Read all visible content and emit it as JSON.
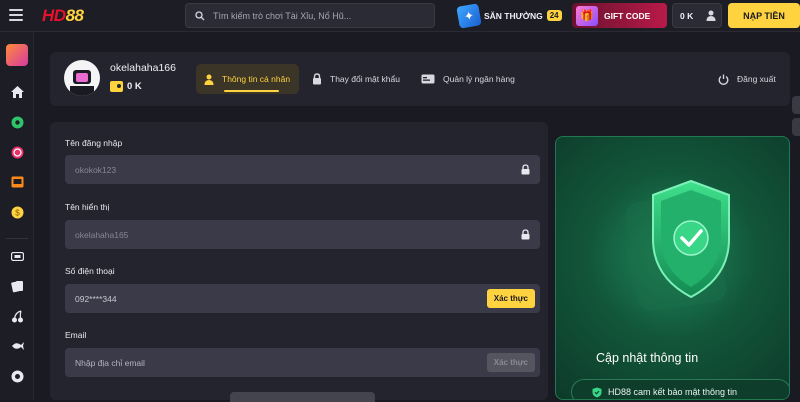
{
  "brand": {
    "logo_text_a": "HD",
    "logo_text_b": "88"
  },
  "search": {
    "placeholder": "Tìm kiếm trò chơi Tài Xỉu, Nổ Hũ..."
  },
  "header": {
    "reward_label": "SĂN THƯỞNG",
    "reward_count": "24",
    "gift_label": "GIFT CODE",
    "balance": "0 K",
    "deposit_label": "NẠP TIỀN"
  },
  "profile": {
    "username": "okelahaha166",
    "coins": "0 K",
    "tabs": [
      {
        "label": "Thông tin cá nhân",
        "icon": "user-icon",
        "active": true
      },
      {
        "label": "Thay đổi mật khẩu",
        "icon": "lock-icon",
        "active": false
      },
      {
        "label": "Quản lý ngân hàng",
        "icon": "bank-card-icon",
        "active": false
      }
    ],
    "logout_label": "Đăng xuất"
  },
  "form": {
    "username_label": "Tên đăng nhập",
    "username_value": "okokok123",
    "display_label": "Tên hiển thị",
    "display_value": "okelahaha165",
    "phone_label": "Số điện thoại",
    "phone_value": "092****344",
    "phone_verify": "Xác thực",
    "email_label": "Email",
    "email_placeholder": "Nhập địa chỉ email",
    "email_verify": "Xác thực"
  },
  "promo": {
    "title": "Cập nhật thông tin",
    "note": "HD88 cam kết bảo mật thông tin"
  },
  "sidebar_icons": [
    "gift-box-icon",
    "home-icon",
    "sports-ball-icon",
    "casino-chip-icon",
    "slot-machine-icon",
    "coin-icon",
    "card-game-icon",
    "playing-cards-icon",
    "cherries-icon",
    "fish-icon",
    "lottery-ball-icon"
  ],
  "colors": {
    "accent": "#ffd23f",
    "brand_red": "#e8102a",
    "background": "#1a1a22",
    "panel": "#24242e",
    "promo_green": "#12563a"
  }
}
